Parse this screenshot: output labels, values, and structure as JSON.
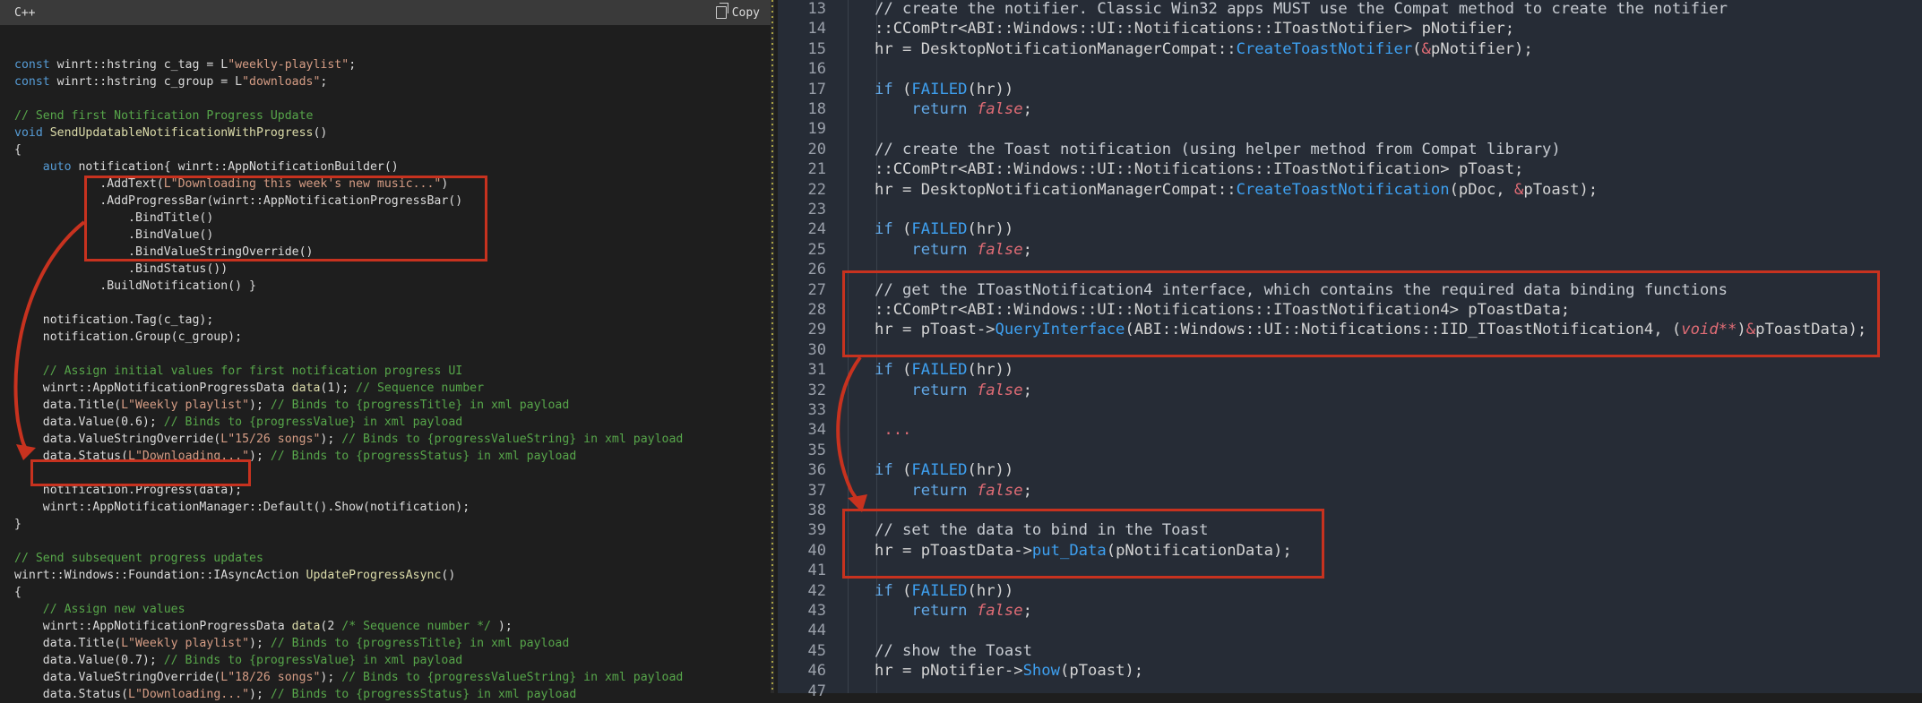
{
  "left_pane": {
    "language": "C++",
    "copy_label": "Copy",
    "lines": [
      [],
      [
        [
          "kw",
          "const "
        ],
        [
          "tx",
          "winrt::hstring c_tag = L"
        ],
        [
          "str",
          "\"weekly-playlist\""
        ],
        [
          "tx",
          ";"
        ]
      ],
      [
        [
          "kw",
          "const "
        ],
        [
          "tx",
          "winrt::hstring c_group = L"
        ],
        [
          "str",
          "\"downloads\""
        ],
        [
          "tx",
          ";"
        ]
      ],
      [],
      [
        [
          "cm",
          "// Send first Notification Progress Update"
        ]
      ],
      [
        [
          "kw",
          "void "
        ],
        [
          "fn",
          "SendUpdatableNotificationWithProgress"
        ],
        [
          "tx",
          "()"
        ]
      ],
      [
        [
          "tx",
          "{"
        ]
      ],
      [
        [
          "tx",
          "    "
        ],
        [
          "kw",
          "auto "
        ],
        [
          "tx",
          "notification{ winrt::AppNotificationBuilder()"
        ]
      ],
      [
        [
          "tx",
          "            .AddText("
        ],
        [
          "str",
          "L\"Downloading this week's new music...\""
        ],
        [
          "tx",
          ")"
        ]
      ],
      [
        [
          "tx",
          "            .AddProgressBar(winrt::AppNotificationProgressBar()"
        ]
      ],
      [
        [
          "tx",
          "                .BindTitle()"
        ]
      ],
      [
        [
          "tx",
          "                .BindValue()"
        ]
      ],
      [
        [
          "tx",
          "                .BindValueStringOverride()"
        ]
      ],
      [
        [
          "tx",
          "                .BindStatus())"
        ]
      ],
      [
        [
          "tx",
          "            .BuildNotification() }"
        ]
      ],
      [],
      [
        [
          "tx",
          "    notification.Tag(c_tag);"
        ]
      ],
      [
        [
          "tx",
          "    notification.Group(c_group);"
        ]
      ],
      [],
      [
        [
          "tx",
          "    "
        ],
        [
          "cm",
          "// Assign initial values for first notification progress UI"
        ]
      ],
      [
        [
          "tx",
          "    winrt::AppNotificationProgressData "
        ],
        [
          "fn",
          "data"
        ],
        [
          "tx",
          "(1); "
        ],
        [
          "cm",
          "// Sequence number"
        ]
      ],
      [
        [
          "tx",
          "    data.Title("
        ],
        [
          "str",
          "L\"Weekly playlist\""
        ],
        [
          "tx",
          "); "
        ],
        [
          "cm",
          "// Binds to {progressTitle} in xml payload"
        ]
      ],
      [
        [
          "tx",
          "    data.Value(0.6); "
        ],
        [
          "cm",
          "// Binds to {progressValue} in xml payload"
        ]
      ],
      [
        [
          "tx",
          "    data.ValueStringOverride("
        ],
        [
          "str",
          "L\"15/26 songs\""
        ],
        [
          "tx",
          "); "
        ],
        [
          "cm",
          "// Binds to {progressValueString} in xml payload"
        ]
      ],
      [
        [
          "tx",
          "    data.Status("
        ],
        [
          "str",
          "L\"Downloading...\""
        ],
        [
          "tx",
          "); "
        ],
        [
          "cm",
          "// Binds to {progressStatus} in xml payload"
        ]
      ],
      [],
      [
        [
          "tx",
          "    notification.Progress(data);"
        ]
      ],
      [
        [
          "tx",
          "    winrt::AppNotificationManager::Default().Show(notification);"
        ]
      ],
      [
        [
          "tx",
          "}"
        ]
      ],
      [],
      [
        [
          "cm",
          "// Send subsequent progress updates"
        ]
      ],
      [
        [
          "tx",
          "winrt::Windows::Foundation::IAsyncAction "
        ],
        [
          "fn",
          "UpdateProgressAsync"
        ],
        [
          "tx",
          "()"
        ]
      ],
      [
        [
          "tx",
          "{"
        ]
      ],
      [
        [
          "tx",
          "    "
        ],
        [
          "cm",
          "// Assign new values"
        ]
      ],
      [
        [
          "tx",
          "    winrt::AppNotificationProgressData "
        ],
        [
          "fn",
          "data"
        ],
        [
          "tx",
          "(2 "
        ],
        [
          "cm",
          "/* Sequence number */"
        ],
        [
          "tx",
          " );"
        ]
      ],
      [
        [
          "tx",
          "    data.Title("
        ],
        [
          "str",
          "L\"Weekly playlist\""
        ],
        [
          "tx",
          "); "
        ],
        [
          "cm",
          "// Binds to {progressTitle} in xml payload"
        ]
      ],
      [
        [
          "tx",
          "    data.Value(0.7); "
        ],
        [
          "cm",
          "// Binds to {progressValue} in xml payload"
        ]
      ],
      [
        [
          "tx",
          "    data.ValueStringOverride("
        ],
        [
          "str",
          "L\"18/26 songs\""
        ],
        [
          "tx",
          "); "
        ],
        [
          "cm",
          "// Binds to {progressValueString} in xml payload"
        ]
      ],
      [
        [
          "tx",
          "    data.Status("
        ],
        [
          "str",
          "L\"Downloading...\""
        ],
        [
          "tx",
          "); "
        ],
        [
          "cm",
          "// Binds to {progressStatus} in xml payload"
        ]
      ]
    ]
  },
  "right_pane": {
    "line_numbers": [
      "13",
      "14",
      "15",
      "16",
      "17",
      "18",
      "19",
      "20",
      "21",
      "22",
      "23",
      "24",
      "25",
      "26",
      "27",
      "28",
      "29",
      "30",
      "31",
      "32",
      "33",
      "34",
      "35",
      "36",
      "37",
      "38",
      "39",
      "40",
      "41",
      "42",
      "43",
      "44",
      "45",
      "46",
      "47"
    ],
    "lines": [
      [
        [
          "cm",
          "// create the notifier. Classic Win32 apps MUST use the Compat method to create the notifier"
        ]
      ],
      [
        [
          "tx",
          "::CComPtr"
        ],
        [
          "op",
          "<"
        ],
        [
          "ty",
          "ABI::Windows::UI::Notifications::IToastNotifier"
        ],
        [
          "op",
          "> "
        ],
        [
          "tx",
          "pNotifier;"
        ]
      ],
      [
        [
          "tx",
          "hr = DesktopNotificationManagerCompat::"
        ],
        [
          "fn",
          "CreateToastNotifier"
        ],
        [
          "tx",
          "("
        ],
        [
          "pk",
          "&"
        ],
        [
          "tx",
          "pNotifier);"
        ]
      ],
      [],
      [
        [
          "kw",
          "if "
        ],
        [
          "tx",
          "("
        ],
        [
          "fn",
          "FAILED"
        ],
        [
          "tx",
          "(hr))"
        ]
      ],
      [
        [
          "tx",
          "    "
        ],
        [
          "kw",
          "return "
        ],
        [
          "fl",
          "false"
        ],
        [
          "tx",
          ";"
        ]
      ],
      [],
      [
        [
          "cm",
          "// create the Toast notification (using helper method from Compat library)"
        ]
      ],
      [
        [
          "tx",
          "::CComPtr"
        ],
        [
          "op",
          "<"
        ],
        [
          "ty",
          "ABI::Windows::UI::Notifications::IToastNotification"
        ],
        [
          "op",
          "> "
        ],
        [
          "tx",
          "pToast;"
        ]
      ],
      [
        [
          "tx",
          "hr = DesktopNotificationManagerCompat::"
        ],
        [
          "fn",
          "CreateToastNotification"
        ],
        [
          "tx",
          "(pDoc, "
        ],
        [
          "pk",
          "&"
        ],
        [
          "tx",
          "pToast);"
        ]
      ],
      [],
      [
        [
          "kw",
          "if "
        ],
        [
          "tx",
          "("
        ],
        [
          "fn",
          "FAILED"
        ],
        [
          "tx",
          "(hr))"
        ]
      ],
      [
        [
          "tx",
          "    "
        ],
        [
          "kw",
          "return "
        ],
        [
          "fl",
          "false"
        ],
        [
          "tx",
          ";"
        ]
      ],
      [],
      [
        [
          "cm",
          "// get the IToastNotification4 interface, which contains the required data binding functions"
        ]
      ],
      [
        [
          "tx",
          "::CComPtr"
        ],
        [
          "op",
          "<"
        ],
        [
          "ty",
          "ABI::Windows::UI::Notifications::IToastNotification4"
        ],
        [
          "op",
          "> "
        ],
        [
          "tx",
          "pToastData;"
        ]
      ],
      [
        [
          "tx",
          "hr = pToast"
        ],
        [
          "op",
          "->"
        ],
        [
          "fn",
          "QueryInterface"
        ],
        [
          "tx",
          "(ABI::Windows::UI::Notifications::IID_IToastNotification4, ("
        ],
        [
          "fl",
          "void**"
        ],
        [
          "tx",
          ")"
        ],
        [
          "pk",
          "&"
        ],
        [
          "tx",
          "pToastData);"
        ]
      ],
      [],
      [
        [
          "kw",
          "if "
        ],
        [
          "tx",
          "("
        ],
        [
          "fn",
          "FAILED"
        ],
        [
          "tx",
          "(hr))"
        ]
      ],
      [
        [
          "tx",
          "    "
        ],
        [
          "kw",
          "return "
        ],
        [
          "fl",
          "false"
        ],
        [
          "tx",
          ";"
        ]
      ],
      [],
      [
        [
          "pk",
          " ..."
        ]
      ],
      [],
      [
        [
          "kw",
          "if "
        ],
        [
          "tx",
          "("
        ],
        [
          "fn",
          "FAILED"
        ],
        [
          "tx",
          "(hr))"
        ]
      ],
      [
        [
          "tx",
          "    "
        ],
        [
          "kw",
          "return "
        ],
        [
          "fl",
          "false"
        ],
        [
          "tx",
          ";"
        ]
      ],
      [],
      [
        [
          "cm",
          "// set the data to bind in the Toast"
        ]
      ],
      [
        [
          "tx",
          "hr = pToastData"
        ],
        [
          "op",
          "->"
        ],
        [
          "fn",
          "put_Data"
        ],
        [
          "tx",
          "(pNotificationData);"
        ]
      ],
      [],
      [
        [
          "kw",
          "if "
        ],
        [
          "tx",
          "("
        ],
        [
          "fn",
          "FAILED"
        ],
        [
          "tx",
          "(hr))"
        ]
      ],
      [
        [
          "tx",
          "    "
        ],
        [
          "kw",
          "return "
        ],
        [
          "fl",
          "false"
        ],
        [
          "tx",
          ";"
        ]
      ],
      [],
      [
        [
          "cm",
          "// show the Toast"
        ]
      ],
      [
        [
          "tx",
          "hr = pNotifier"
        ],
        [
          "op",
          "->"
        ],
        [
          "fn",
          "Show"
        ],
        [
          "tx",
          "(pToast);"
        ]
      ],
      []
    ]
  },
  "colors": {
    "highlight": "#c7321f",
    "left_background": "#1e1e1e",
    "right_background": "#262c36"
  }
}
